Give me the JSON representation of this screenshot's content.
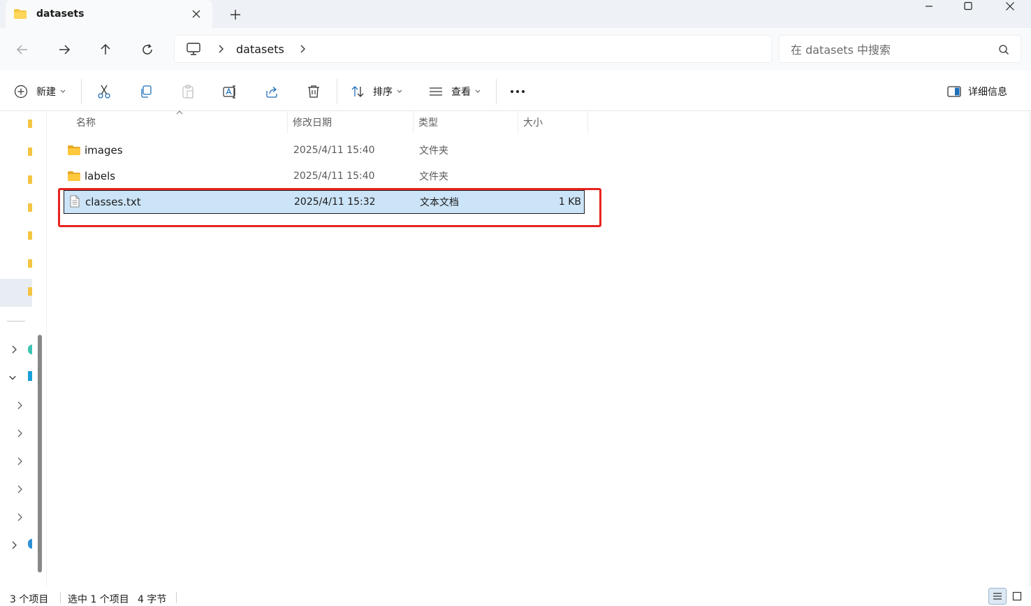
{
  "window": {
    "tab_title": "datasets",
    "new_tab_label": "+"
  },
  "navigation": {
    "breadcrumb": [
      "datasets"
    ],
    "search_placeholder": "在 datasets 中搜索"
  },
  "toolbar": {
    "new_label": "新建",
    "sort_label": "排序",
    "view_label": "查看",
    "details_label": "详细信息"
  },
  "columns": {
    "name": "名称",
    "modified": "修改日期",
    "type": "类型",
    "size": "大小"
  },
  "files": [
    {
      "name": "images",
      "modified": "2025/4/11 15:40",
      "type": "文件夹",
      "size": "",
      "icon": "folder-icon",
      "selected": false
    },
    {
      "name": "labels",
      "modified": "2025/4/11 15:40",
      "type": "文件夹",
      "size": "",
      "icon": "folder-icon",
      "selected": false
    },
    {
      "name": "classes.txt",
      "modified": "2025/4/11 15:32",
      "type": "文本文档",
      "size": "1 KB",
      "icon": "text-file-icon",
      "selected": true
    }
  ],
  "status": {
    "item_count": "3 个项目",
    "selection": "选中 1 个项目",
    "selection_size": "4 字节"
  },
  "colors": {
    "accent": "#0067c0",
    "selection": "#cce4f7",
    "highlight_box": "#e8231f",
    "folder": "#f4c542"
  }
}
